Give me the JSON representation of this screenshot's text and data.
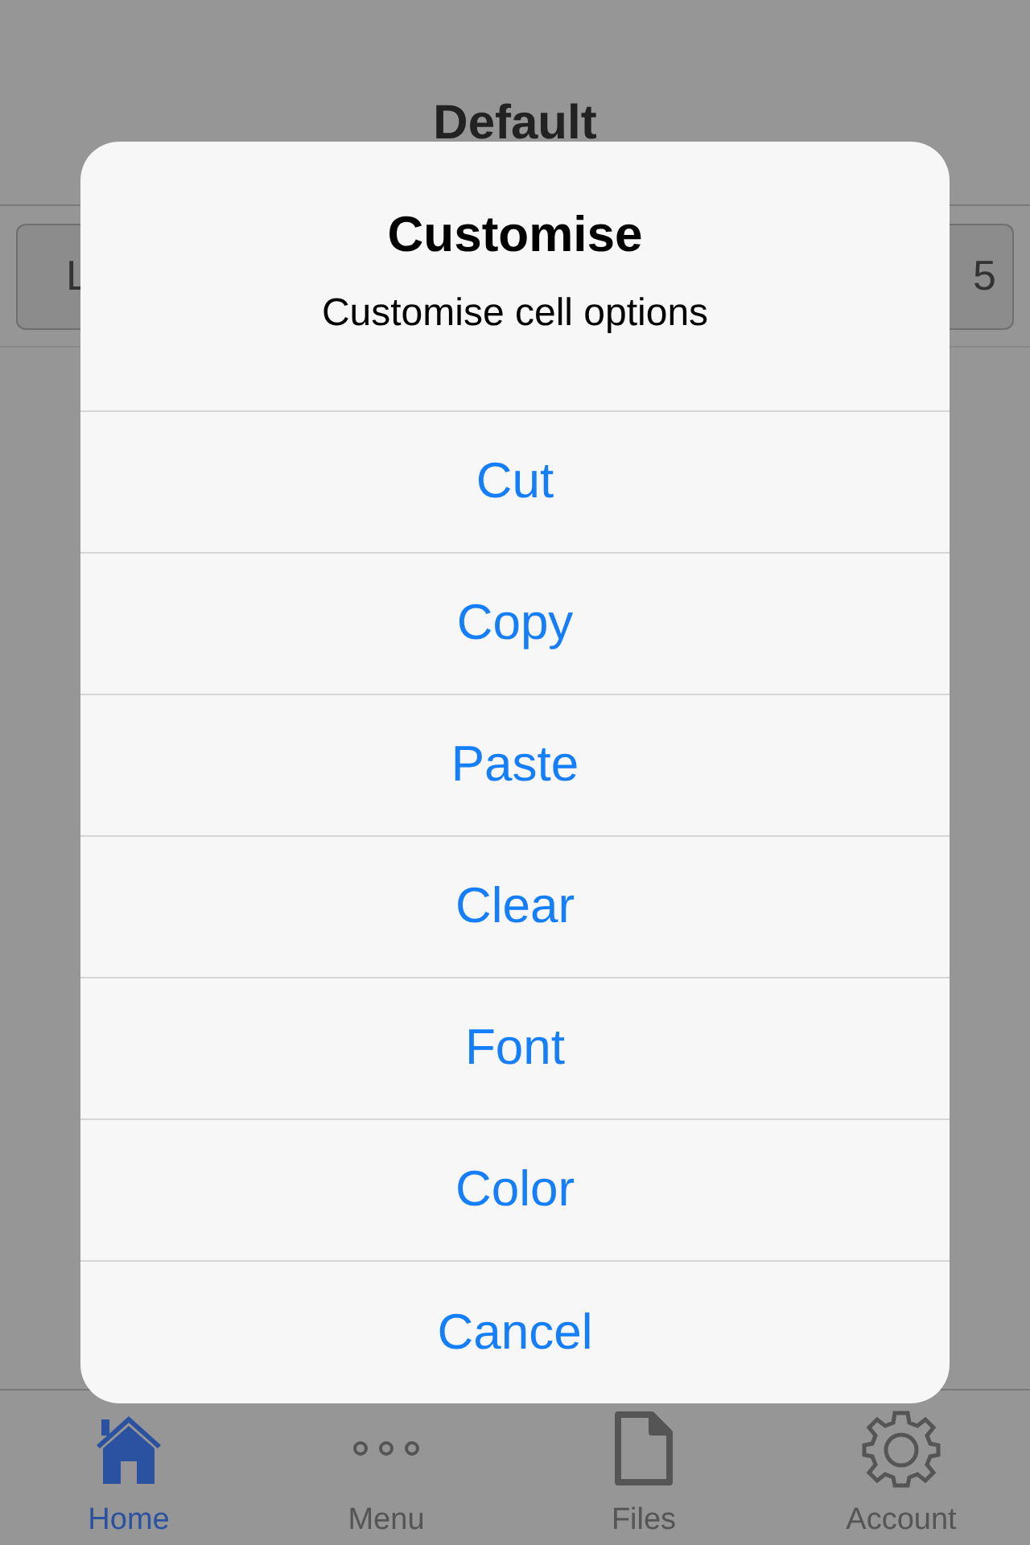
{
  "screen": {
    "title": "Default",
    "buttons": [
      "L",
      "5"
    ]
  },
  "dialog": {
    "title": "Customise",
    "message": "Customise cell options",
    "actions": [
      "Cut",
      "Copy",
      "Paste",
      "Clear",
      "Font",
      "Color",
      "Cancel"
    ]
  },
  "tab_bar": [
    {
      "label": "Home",
      "kind": "home",
      "selected": true
    },
    {
      "label": "Menu",
      "kind": "more",
      "selected": false
    },
    {
      "label": "Files",
      "kind": "file",
      "selected": false
    },
    {
      "label": "Account",
      "kind": "gear",
      "selected": false
    }
  ]
}
